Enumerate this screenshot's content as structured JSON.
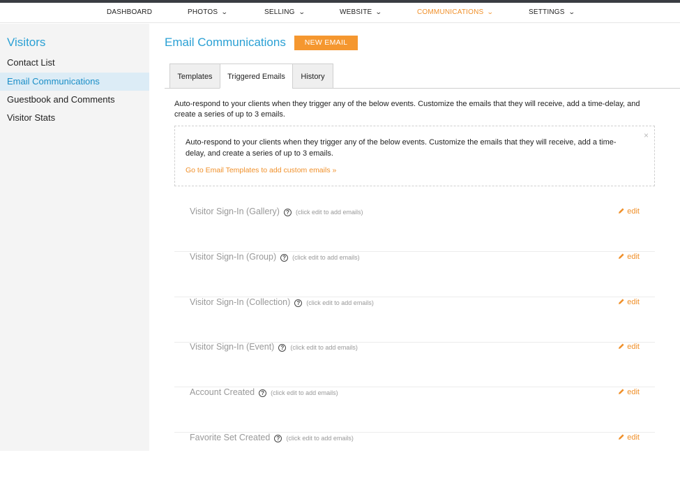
{
  "nav": [
    {
      "label": "DASHBOARD",
      "chevron": false
    },
    {
      "label": "PHOTOS",
      "chevron": true
    },
    {
      "label": "SELLING",
      "chevron": true
    },
    {
      "label": "WEBSITE",
      "chevron": true
    },
    {
      "label": "COMMUNICATIONS",
      "chevron": true,
      "active": true
    },
    {
      "label": "SETTINGS",
      "chevron": true
    }
  ],
  "sidebar": {
    "title": "Visitors",
    "items": [
      {
        "label": "Contact List"
      },
      {
        "label": "Email Communications",
        "active": true
      },
      {
        "label": "Guestbook and Comments"
      },
      {
        "label": "Visitor Stats"
      }
    ]
  },
  "main": {
    "title": "Email Communications",
    "new_button": "NEW EMAIL",
    "tabs": [
      {
        "label": "Templates"
      },
      {
        "label": "Triggered Emails",
        "active": true
      },
      {
        "label": "History"
      }
    ],
    "intro": "Auto-respond to your clients when they trigger any of the below events. Customize the emails that they will receive, add a time-delay, and create a series of up to 3 emails.",
    "notice": {
      "text": "Auto-respond to your clients when they trigger any of the below events. Customize the emails that they will receive, add a time-delay, and create a series of up to 3 emails.",
      "link": "Go to Email Templates to add custom emails »",
      "close": "×"
    },
    "triggers": [
      {
        "label": "Visitor Sign-In (Gallery)",
        "hint": "(click edit to add emails)",
        "edit": "edit"
      },
      {
        "label": "Visitor Sign-In (Group)",
        "hint": "(click edit to add emails)",
        "edit": "edit"
      },
      {
        "label": "Visitor Sign-In (Collection)",
        "hint": "(click edit to add emails)",
        "edit": "edit"
      },
      {
        "label": "Visitor Sign-In (Event)",
        "hint": "(click edit to add emails)",
        "edit": "edit"
      },
      {
        "label": "Account Created",
        "hint": "(click edit to add emails)",
        "edit": "edit"
      },
      {
        "label": "Favorite Set Created",
        "hint": "(click edit to add emails)",
        "edit": "edit"
      }
    ]
  },
  "colors": {
    "accent_blue": "#2aa0d4",
    "accent_orange": "#f5972f",
    "sidebar_active_bg": "#dcecf6"
  }
}
